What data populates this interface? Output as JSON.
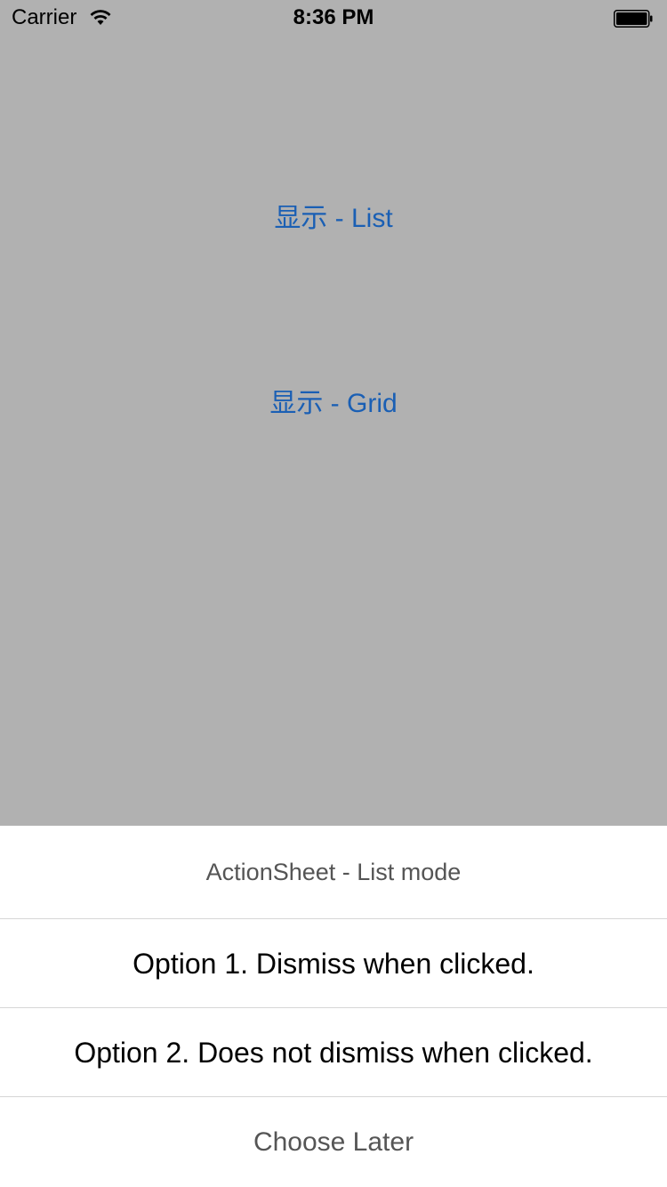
{
  "status_bar": {
    "carrier": "Carrier",
    "time": "8:36 PM",
    "wifi_icon": "wifi-icon",
    "battery_icon": "battery-icon"
  },
  "main": {
    "list_button": "显示 - List",
    "grid_button": "显示 - Grid",
    "accent_color": "#1a5fb4",
    "background_color": "#b1b1b1"
  },
  "action_sheet": {
    "title": "ActionSheet - List mode",
    "options": [
      "Option 1. Dismiss when clicked.",
      "Option 2. Does not dismiss when clicked."
    ],
    "cancel": "Choose Later"
  }
}
